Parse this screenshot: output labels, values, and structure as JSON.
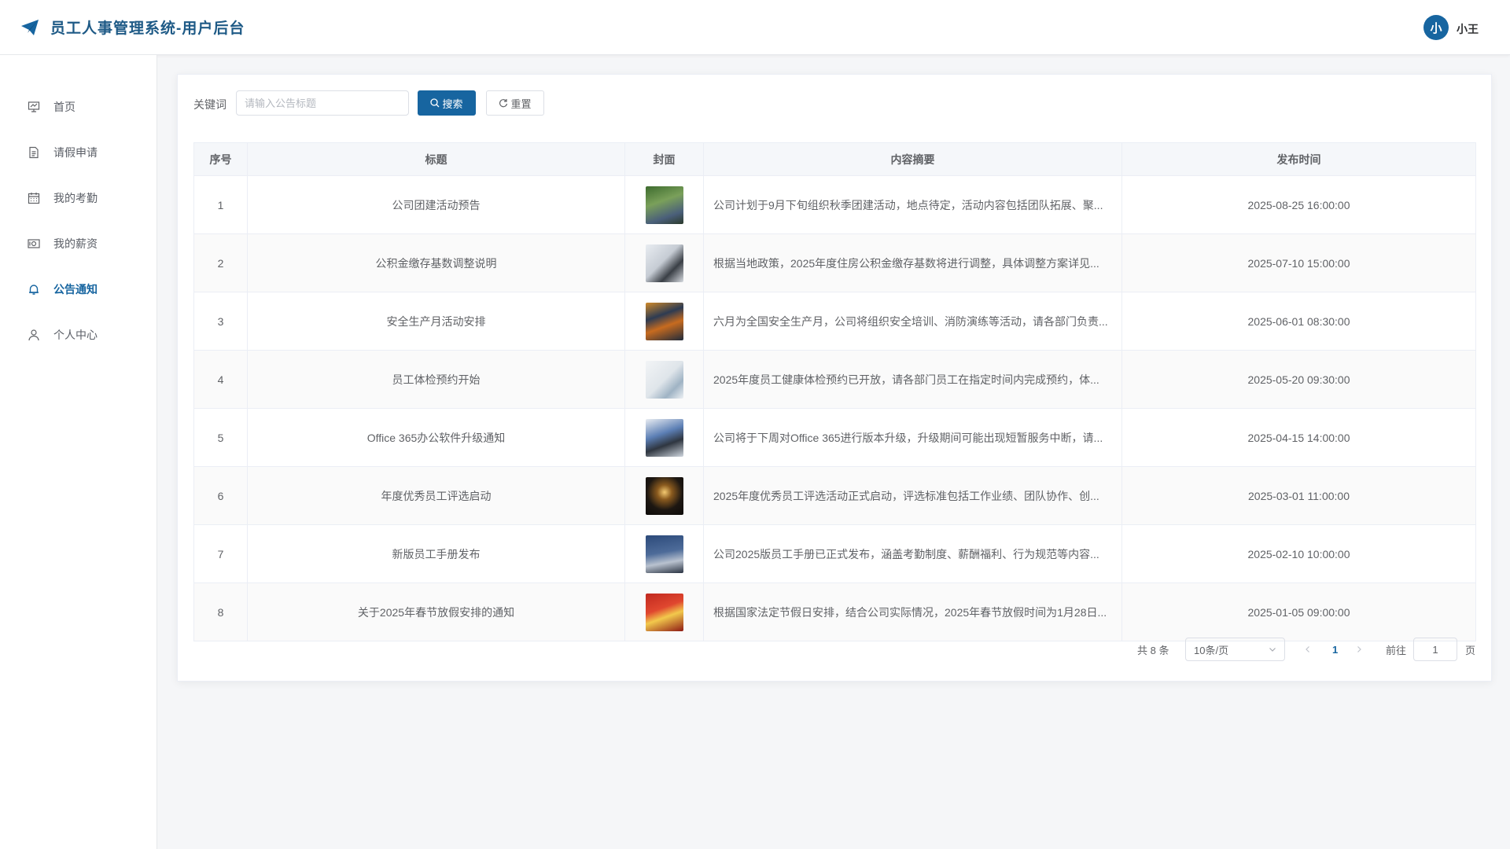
{
  "header": {
    "app_title": "员工人事管理系统-用户后台",
    "avatar_initial": "小",
    "username": "小王"
  },
  "sidebar": {
    "items": [
      {
        "label": "首页",
        "icon": "presentation-board-icon"
      },
      {
        "label": "请假申请",
        "icon": "document-icon"
      },
      {
        "label": "我的考勤",
        "icon": "calendar-icon"
      },
      {
        "label": "我的薪资",
        "icon": "money-icon"
      },
      {
        "label": "公告通知",
        "icon": "bell-icon",
        "active": true
      },
      {
        "label": "个人中心",
        "icon": "user-icon"
      }
    ]
  },
  "search": {
    "label": "关键词",
    "placeholder": "请输入公告标题",
    "search_label": "搜索",
    "reset_label": "重置"
  },
  "table": {
    "columns": [
      "序号",
      "标题",
      "封面",
      "内容摘要",
      "发布时间"
    ],
    "rows": [
      {
        "index": "1",
        "title": "公司团建活动预告",
        "summary": "公司计划于9月下旬组织秋季团建活动，地点待定，活动内容包括团队拓展、聚...",
        "time": "2025-08-25 16:00:00"
      },
      {
        "index": "2",
        "title": "公积金缴存基数调整说明",
        "summary": "根据当地政策，2025年度住房公积金缴存基数将进行调整，具体调整方案详见...",
        "time": "2025-07-10 15:00:00"
      },
      {
        "index": "3",
        "title": "安全生产月活动安排",
        "summary": "六月为全国安全生产月，公司将组织安全培训、消防演练等活动，请各部门负责...",
        "time": "2025-06-01 08:30:00"
      },
      {
        "index": "4",
        "title": "员工体检预约开始",
        "summary": "2025年度员工健康体检预约已开放，请各部门员工在指定时间内完成预约，体...",
        "time": "2025-05-20 09:30:00"
      },
      {
        "index": "5",
        "title": "Office 365办公软件升级通知",
        "summary": "公司将于下周对Office 365进行版本升级，升级期间可能出现短暂服务中断，请...",
        "time": "2025-04-15 14:00:00"
      },
      {
        "index": "6",
        "title": "年度优秀员工评选启动",
        "summary": "2025年度优秀员工评选活动正式启动，评选标准包括工作业绩、团队协作、创...",
        "time": "2025-03-01 11:00:00"
      },
      {
        "index": "7",
        "title": "新版员工手册发布",
        "summary": "公司2025版员工手册已正式发布，涵盖考勤制度、薪酬福利、行为规范等内容...",
        "time": "2025-02-10 10:00:00"
      },
      {
        "index": "8",
        "title": "关于2025年春节放假安排的通知",
        "summary": "根据国家法定节假日安排，结合公司实际情况，2025年春节放假时间为1月28日...",
        "time": "2025-01-05 09:00:00"
      }
    ]
  },
  "pagination": {
    "total": "共 8 条",
    "page_size": "10条/页",
    "current_page": "1",
    "goto_label": "前往",
    "goto_value": "1",
    "page_unit": "页"
  }
}
